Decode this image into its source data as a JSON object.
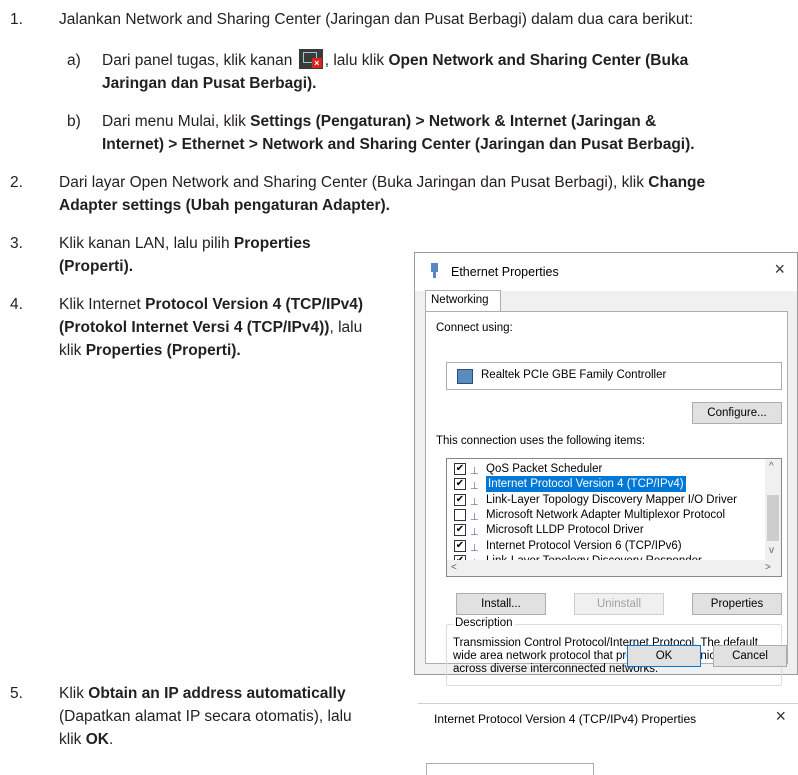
{
  "steps": {
    "s1": {
      "num": "1.",
      "text": "Jalankan Network and Sharing Center (Jaringan dan Pusat Berbagi) dalam dua cara berikut:"
    },
    "s1a": {
      "letter": "a)",
      "pre": "Dari panel tugas, klik kanan",
      "mid": ", lalu klik ",
      "bold1": "Open Network and Sharing Center (Buka",
      "bold2": "Jaringan dan Pusat Berbagi)."
    },
    "s1b": {
      "letter": "b)",
      "pre": "Dari menu Mulai, klik ",
      "bold1": "Settings (Pengaturan) > Network & Internet (Jaringan &",
      "bold2": "Internet) > Ethernet > Network and Sharing Center (Jaringan dan Pusat Berbagi)."
    },
    "s2": {
      "num": "2.",
      "pre": "Dari layar Open Network and Sharing Center (Buka Jaringan dan Pusat Berbagi), klik ",
      "bold1": "Change",
      "bold2": "Adapter settings (Ubah pengaturan Adapter)."
    },
    "s3": {
      "num": "3.",
      "pre": "Klik kanan LAN, lalu pilih ",
      "bold1": "Properties",
      "bold2": "(Properti)."
    },
    "s4": {
      "num": "4.",
      "pre": "Klik Internet ",
      "bold1": "Protocol Version 4 (TCP/IPv4)",
      "bold2": "(Protokol Internet Versi 4 (TCP/IPv4))",
      "mid": ", lalu",
      "pre2": "klik ",
      "bold3": "Properties (Properti)."
    },
    "s5": {
      "num": "5.",
      "pre": "Klik ",
      "bold1": "Obtain an IP address automatically",
      "line2": "(Dapatkan alamat IP secara otomatis), lalu",
      "pre3": "klik ",
      "bold3": "OK",
      "post3": "."
    }
  },
  "dialog": {
    "title": "Ethernet Properties",
    "close": "×",
    "tab": "Networking",
    "connect_using": "Connect using:",
    "adapter": "Realtek PCIe GBE Family Controller",
    "configure": "Configure...",
    "items_label": "This connection uses the following items:",
    "items": [
      {
        "label": "QoS Packet Scheduler",
        "checked": true
      },
      {
        "label": "Internet Protocol Version 4 (TCP/IPv4)",
        "checked": true,
        "selected": true
      },
      {
        "label": "Link-Layer Topology Discovery Mapper I/O Driver",
        "checked": true
      },
      {
        "label": "Microsoft Network Adapter Multiplexor Protocol",
        "checked": false
      },
      {
        "label": "Microsoft LLDP Protocol Driver",
        "checked": true
      },
      {
        "label": "Internet Protocol Version 6 (TCP/IPv6)",
        "checked": true
      },
      {
        "label": "Link-Layer Topology Discovery Responder",
        "checked": true
      }
    ],
    "install": "Install...",
    "uninstall": "Uninstall",
    "properties": "Properties",
    "description_legend": "Description",
    "description": "Transmission Control Protocol/Internet Protocol. The default wide area network protocol that provides communication across diverse interconnected networks.",
    "ok": "OK",
    "cancel": "Cancel"
  },
  "dialog2": {
    "title": "Internet Protocol Version 4 (TCP/IPv4) Properties",
    "close": "×"
  },
  "colors": {
    "selection": "#0078d7",
    "tray_error": "#d9241c"
  }
}
